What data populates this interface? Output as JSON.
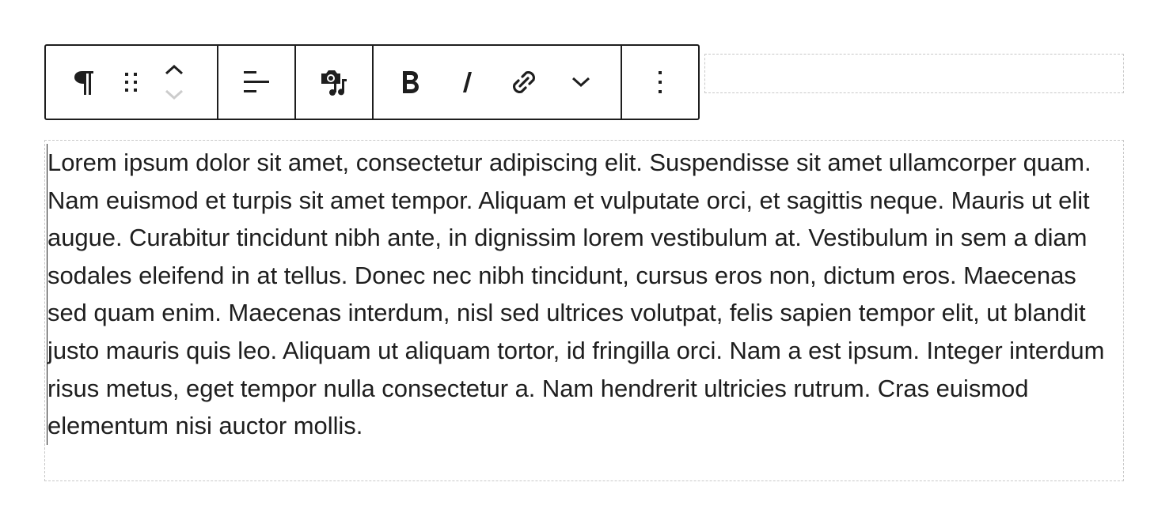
{
  "toolbar": {
    "block_type_icon": "paragraph-icon",
    "drag_handle_icon": "drag-handle-icon",
    "move_up_icon": "chevron-up-icon",
    "move_down_icon": "chevron-down-icon",
    "align_icon": "align-left-icon",
    "media_icon": "camera-music-icon",
    "bold_icon": "bold-icon",
    "italic_icon": "italic-icon",
    "link_icon": "link-icon",
    "more_formats_icon": "chevron-down-icon",
    "options_icon": "more-vertical-icon"
  },
  "paragraph": {
    "text": "Lorem ipsum dolor sit amet, consectetur adipiscing elit. Suspendisse sit amet ullamcorper quam. Nam euismod et turpis sit amet tempor. Aliquam et vulputate orci, et sagittis neque. Mauris ut elit augue. Curabitur tincidunt nibh ante, in dignissim lorem vestibulum at. Vestibulum in sem a diam sodales eleifend in at tellus. Donec nec nibh tincidunt, cursus eros non, dictum eros. Maecenas sed quam enim. Maecenas interdum, nisl sed ultrices volutpat, felis sapien tempor elit, ut blandit justo mauris quis leo. Aliquam ut aliquam tortor, id fringilla orci. Nam a est ipsum. Integer interdum risus metus, eget tempor nulla consectetur a. Nam hendrerit ultricies rutrum. Cras euismod elementum nisi auctor mollis."
  },
  "colors": {
    "text": "#1e1e1e",
    "toolbar_border": "#1e1e1e",
    "block_outline": "#c8c8c8",
    "disabled": "#cccccc"
  }
}
